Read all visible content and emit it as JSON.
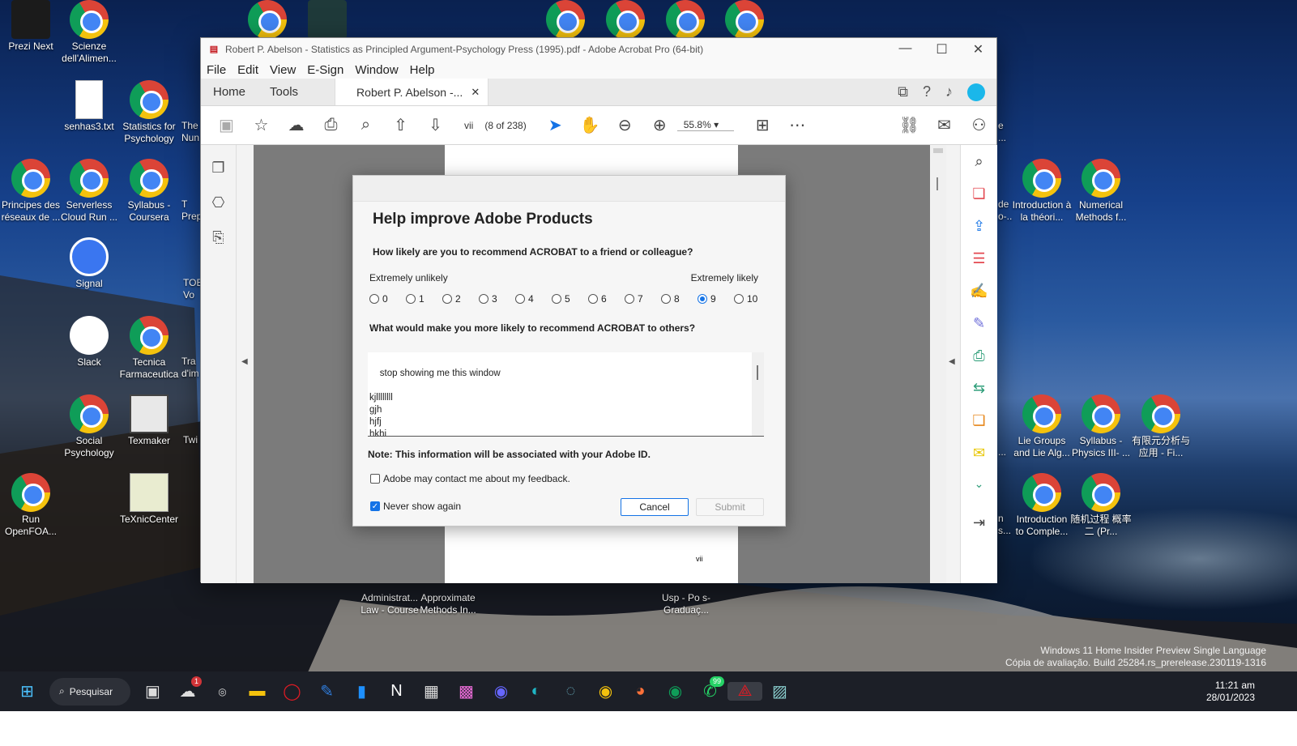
{
  "desktop": {
    "icons": [
      {
        "label": "Prezi Next",
        "kind": "prezi-icon"
      },
      {
        "label": "Scienze dell'Alimen...",
        "kind": "chrome-icon"
      },
      {
        "label": "senhas3.txt",
        "kind": "text-file-icon"
      },
      {
        "label": "Statistics for Psychology",
        "kind": "chrome-icon"
      },
      {
        "label": "Principes des réseaux de ...",
        "kind": "chrome-icon"
      },
      {
        "label": "Serverless Cloud Run ...",
        "kind": "chrome-icon"
      },
      {
        "label": "Syllabus - Coursera",
        "kind": "chrome-icon"
      },
      {
        "label": "Signal",
        "kind": "signal-icon"
      },
      {
        "label": "Slack",
        "kind": "slack-icon"
      },
      {
        "label": "Tecnica Farmaceutica",
        "kind": "chrome-icon"
      },
      {
        "label": "Social Psychology",
        "kind": "chrome-icon"
      },
      {
        "label": "Texmaker",
        "kind": "texmaker-icon"
      },
      {
        "label": "Run OpenFOA...",
        "kind": "chrome-icon"
      },
      {
        "label": "TeXnicCenter",
        "kind": "texniccenter-icon"
      },
      {
        "label": "Introduction à la théori...",
        "kind": "chrome-icon"
      },
      {
        "label": "Numerical Methods f...",
        "kind": "chrome-icon"
      },
      {
        "label": "Lie Groups and Lie Alg...",
        "kind": "chrome-icon"
      },
      {
        "label": "Syllabus - Physics III- ...",
        "kind": "chrome-icon"
      },
      {
        "label": "有限元分析与应用 - Fi...",
        "kind": "chrome-icon"
      },
      {
        "label": "Introduction to Comple...",
        "kind": "chrome-icon"
      },
      {
        "label": "随机过程 概率二 (Pr...",
        "kind": "chrome-icon"
      }
    ],
    "partial_labels": {
      "col3_row2": "The Nun",
      "col3_row3": "T Prep",
      "col3_row4": "TOE Vo",
      "col3_row5": "Tra d'im",
      "col3_row6": "Twi",
      "right_row3": "de o-...",
      "right_row2": "e ...",
      "right_row6": "...",
      "right_row7": "n s...",
      "bottom1": "Administrat... Law - Course",
      "bottom2": "Approximate Methods In...",
      "bottom3": "Usp - Po s-Graduaç..."
    },
    "watermark_line1": "Windows 11 Home Insider Preview Single Language",
    "watermark_line2": "Cópia de avaliação. Build 25284.rs_prerelease.230119-1316"
  },
  "acrobat": {
    "title": "Robert P. Abelson - Statistics as Principled Argument-Psychology Press (1995).pdf - Adobe Acrobat Pro (64-bit)",
    "menu": [
      "File",
      "Edit",
      "View",
      "E-Sign",
      "Window",
      "Help"
    ],
    "tabs": {
      "home": "Home",
      "tools": "Tools",
      "doc": "Robert P. Abelson -..."
    },
    "page_label": "vii",
    "page_count": "(8 of 238)",
    "zoom": "55.8%",
    "page_footer": "vii"
  },
  "dialog": {
    "title": "Help improve Adobe Products",
    "question1": "How likely are you to recommend ACROBAT to a friend or colleague?",
    "scale_low": "Extremely unlikely",
    "scale_high": "Extremely likely",
    "options": [
      "0",
      "1",
      "2",
      "3",
      "4",
      "5",
      "6",
      "7",
      "8",
      "9",
      "10"
    ],
    "selected": "9",
    "question2": "What would make you more likely to recommend ACROBAT to others?",
    "feedback": "stop showing me this window\n\nkjllllllll\ngjh\nhjfj\nhkhj\nfg",
    "note": "Note: This information will be associated with your Adobe ID.",
    "contact_label": "Adobe may contact me about my feedback.",
    "contact_checked": false,
    "never_label": "Never show again",
    "never_checked": true,
    "cancel": "Cancel",
    "submit": "Submit"
  },
  "taskbar": {
    "search": "Pesquisar",
    "time": "11:21 am",
    "date": "28/01/2023",
    "onedrive_badge": "1",
    "whatsapp_badge": "99"
  }
}
